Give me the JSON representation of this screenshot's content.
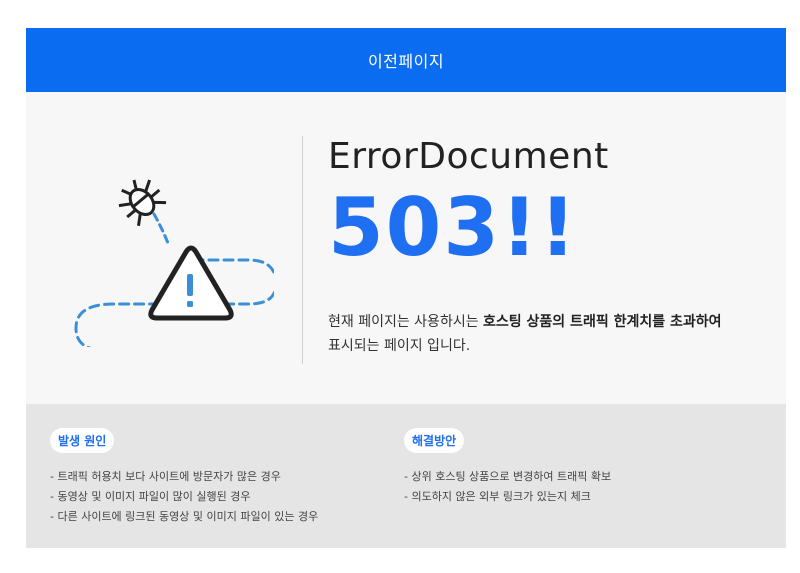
{
  "header": {
    "back_label": "이전페이지"
  },
  "error": {
    "title": "ErrorDocument",
    "code": "503!!",
    "desc_part1": "현재 페이지는 사용하시는 ",
    "desc_bold": "호스팅 상품의 트래픽 한계치를 초과하여",
    "desc_part2": "표시되는 페이지 입니다."
  },
  "causes": {
    "label": "발생 원인",
    "items": [
      "- 트래픽 허용치 보다 사이트에 방문자가 많은 경우",
      "- 동영상 및 이미지 파일이 많이 실행된 경우",
      "- 다른 사이트에 링크된 동영상 및 이미지 파일이 있는 경우"
    ]
  },
  "solutions": {
    "label": "해결방안",
    "items": [
      "- 상위 호스팅 상품으로 변경하여 트래픽 확보",
      "- 의도하지 않은 외부 링크가 있는지 체크"
    ]
  },
  "colors": {
    "accent": "#1f6ff2",
    "header_bg": "#0a6cf1",
    "info_bg": "#e5e5e5",
    "dash": "#3a8fd6"
  },
  "icons": {
    "bug": "bug-icon",
    "warning": "warning-triangle-icon"
  }
}
